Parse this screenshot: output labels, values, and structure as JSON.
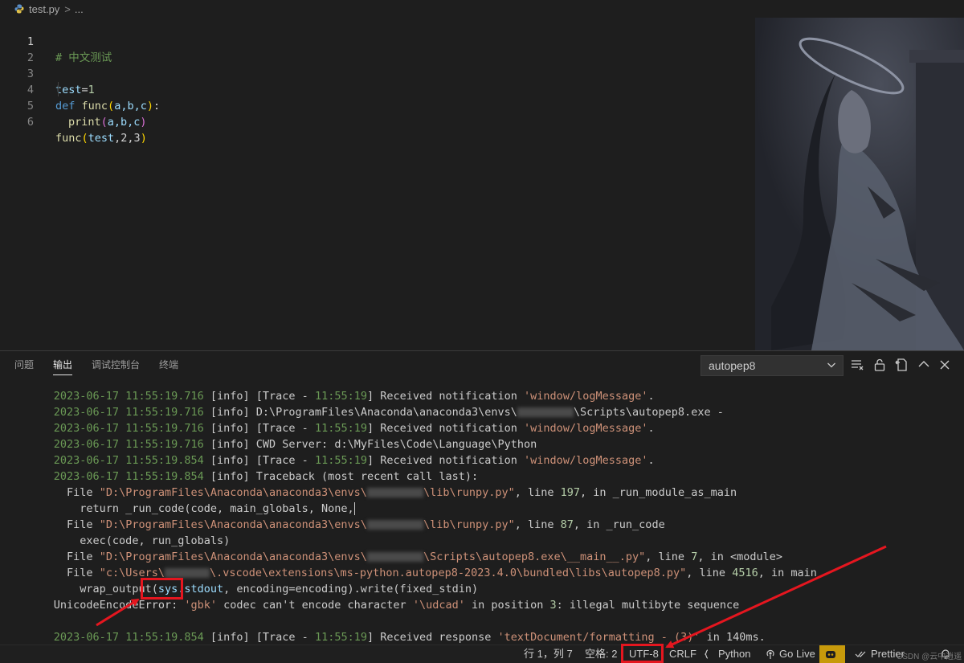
{
  "breadcrumb": {
    "file": "test.py",
    "separator": ">",
    "more": "..."
  },
  "editor": {
    "line_numbers": [
      "1",
      "2",
      "3",
      "4",
      "5",
      "6"
    ],
    "lines": {
      "l1": {
        "comment": "# 中文测试"
      },
      "l3": {
        "var": "test",
        "eq": "=",
        "num": "1"
      },
      "l4": {
        "kw": "def",
        "fn": "func",
        "open": "(",
        "args": "a,b,c",
        "close": ")",
        "colon": ":"
      },
      "l5": {
        "fn": "print",
        "open": "(",
        "args": "a,b,c",
        "close": ")"
      },
      "l6": {
        "fn": "func",
        "open": "(",
        "var": "test",
        "rest": ",2,3",
        "close": ")"
      }
    }
  },
  "panel": {
    "tabs": [
      "问题",
      "输出",
      "调试控制台",
      "终端"
    ],
    "active_tab": "输出",
    "channel": "autopep8",
    "actions": [
      "clear-output-icon",
      "lock-icon",
      "open-in-editor-icon",
      "maximize-panel-icon",
      "close-panel-icon"
    ]
  },
  "output": {
    "l0": {
      "ts": "2023-06-17 11:55:19.716",
      "level": "[info]",
      "pre": "[Trace - ",
      "time": "11:55:19",
      "post": "] Received notification ",
      "str": "'window/logMessage'",
      "end": "."
    },
    "l1": {
      "ts": "2023-06-17 11:55:19.716",
      "level": "[info]",
      "a": "D:\\ProgramFiles\\Anaconda\\anaconda3\\envs\\",
      "b": "\\Scripts\\autopep8.exe -"
    },
    "l2": {
      "ts": "2023-06-17 11:55:19.716",
      "level": "[info]",
      "pre": "[Trace - ",
      "time": "11:55:19",
      "post": "] Received notification ",
      "str": "'window/logMessage'",
      "end": "."
    },
    "l3": {
      "ts": "2023-06-17 11:55:19.716",
      "level": "[info]",
      "text": "CWD Server: d:\\MyFiles\\Code\\Language\\Python"
    },
    "l4": {
      "ts": "2023-06-17 11:55:19.854",
      "level": "[info]",
      "pre": "[Trace - ",
      "time": "11:55:19",
      "post": "] Received notification ",
      "str": "'window/logMessage'",
      "end": "."
    },
    "l5": {
      "ts": "2023-06-17 11:55:19.854",
      "level": "[info]",
      "text": "Traceback (most recent call last):"
    },
    "l6": {
      "pre": "  File ",
      "path_a": "\"D:\\ProgramFiles\\Anaconda\\anaconda3\\envs\\",
      "path_b": "\\lib\\runpy.py\"",
      "mid": ", line ",
      "num": "197",
      "end": ", in _run_module_as_main"
    },
    "l7": {
      "text": "    return _run_code(code, main_globals, None,"
    },
    "l8": {
      "pre": "  File ",
      "path_a": "\"D:\\ProgramFiles\\Anaconda\\anaconda3\\envs\\",
      "path_b": "\\lib\\runpy.py\"",
      "mid": ", line ",
      "num": "87",
      "end": ", in _run_code"
    },
    "l9": {
      "text": "    exec(code, run_globals)"
    },
    "l10": {
      "pre": "  File ",
      "path_a": "\"D:\\ProgramFiles\\Anaconda\\anaconda3\\envs\\",
      "path_b": "\\Scripts\\autopep8.exe\\__main__.py\"",
      "mid": ", line ",
      "num": "7",
      "end": ", in <module>"
    },
    "l11": {
      "pre": "  File ",
      "path_a": "\"c:\\Users\\",
      "path_b": "\\.vscode\\extensions\\ms-python.autopep8-2023.4.0\\bundled\\libs\\autopep8.py\"",
      "mid": ", line ",
      "num": "4516",
      "end": ", in main"
    },
    "l12": {
      "pre": "    wrap_output(",
      "var": "sys.stdout",
      "end": ", encoding=encoding).write(fixed_stdin)"
    },
    "l13": {
      "pre": "UnicodeEncodeError: ",
      "str": "'gbk'",
      "mid": " codec can't encode character ",
      "str2": "'\\udcad'",
      "mid2": " in position ",
      "num": "3",
      "end": ": illegal multibyte sequence"
    },
    "l15": {
      "ts": "2023-06-17 11:55:19.854",
      "level": "[info]",
      "pre": "[Trace - ",
      "time": "11:55:19",
      "post": "] Received response ",
      "str": "'textDocument/formatting - (3)'",
      "end": " in 140ms."
    }
  },
  "statusbar": {
    "position": "行 1，列 7",
    "spaces": "空格: 2",
    "encoding": "UTF-8",
    "eol": "CRLF",
    "language": "Python",
    "golive": "Go Live",
    "prettier": "Prettier"
  },
  "watermark": "CSDN @云中逍遥",
  "colors": {
    "highlight": "#e5161f",
    "comment": "#6a9955",
    "string": "#ce9178",
    "keyword": "#569cd6",
    "function": "#dcdcaa",
    "variable": "#9cdcfe",
    "number": "#b5cea8"
  }
}
